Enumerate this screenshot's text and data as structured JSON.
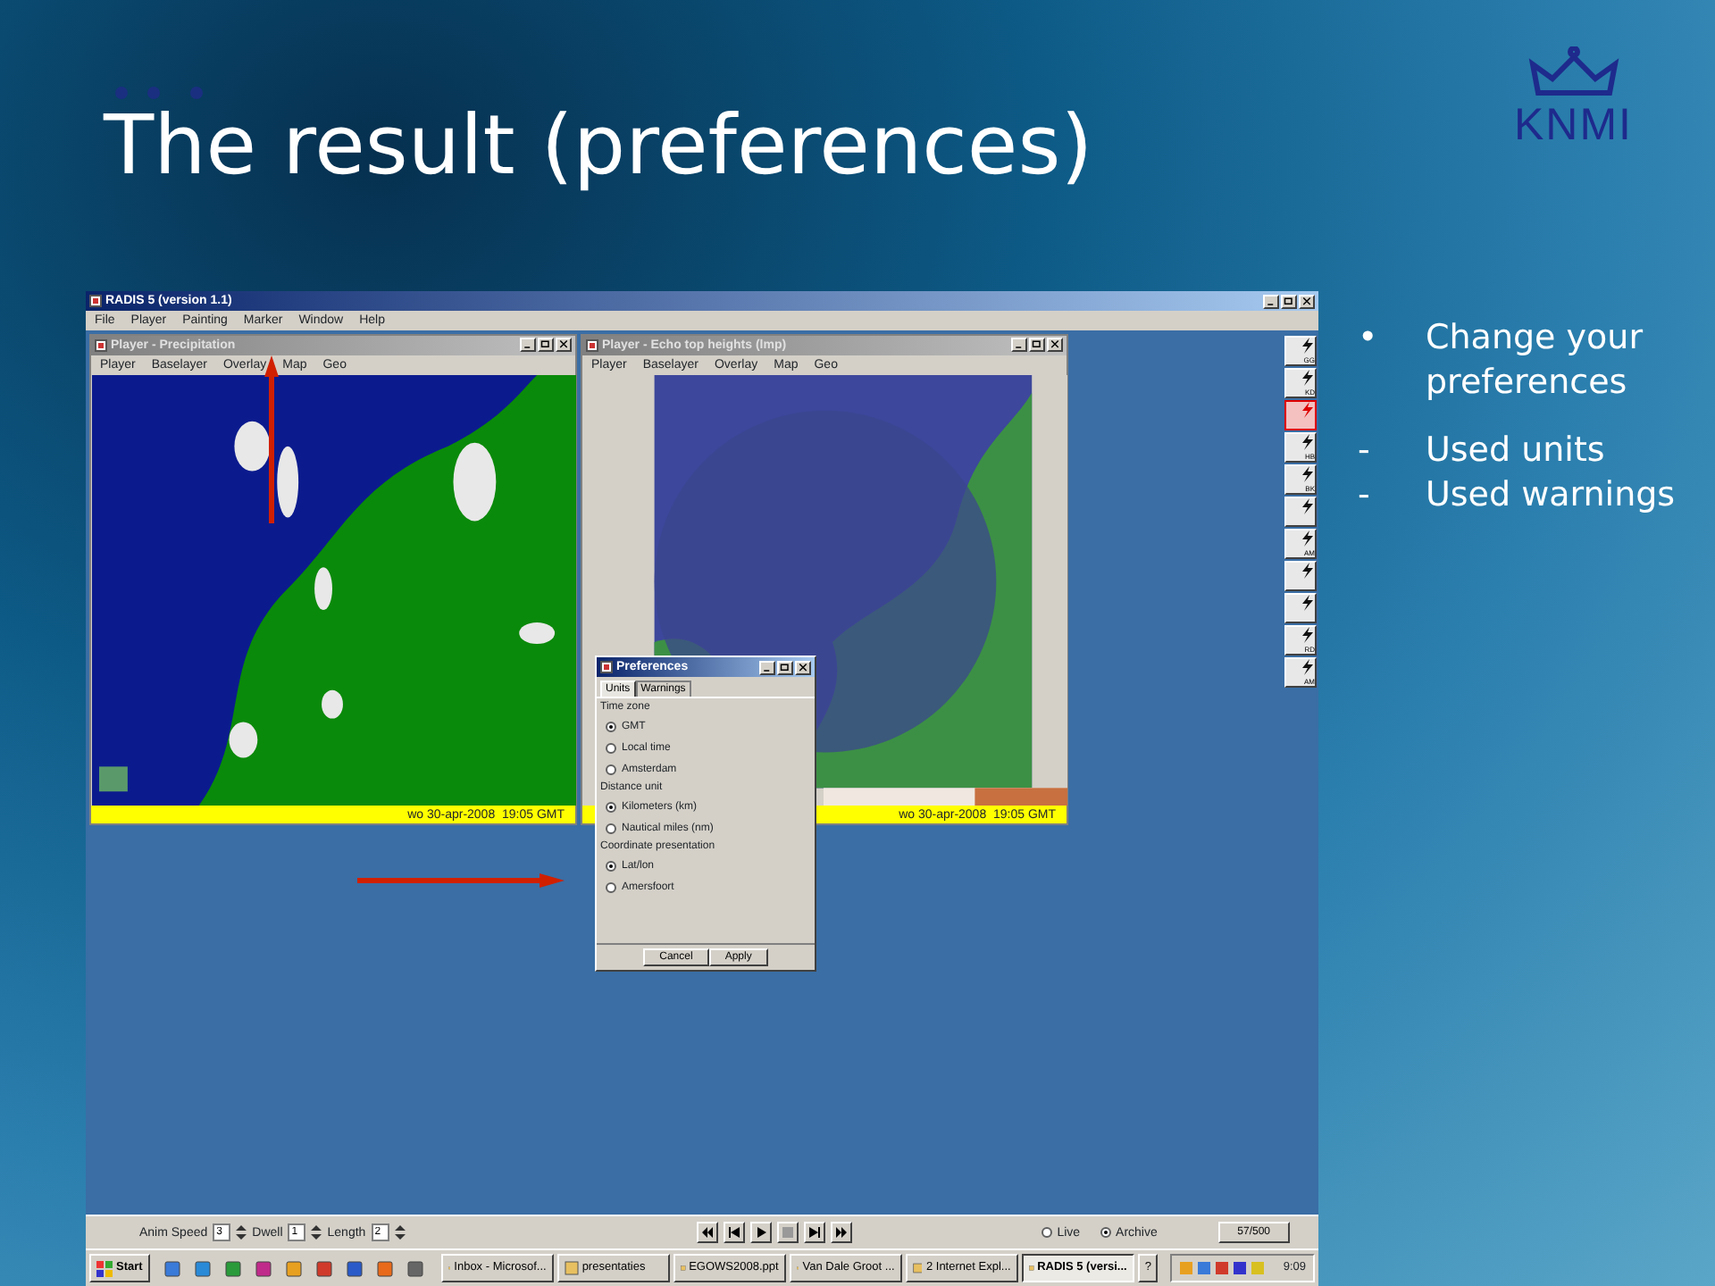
{
  "slide": {
    "title": "The result (preferences)",
    "logo_text": "KNMI"
  },
  "app": {
    "title": "RADIS 5 (version 1.1)",
    "menu": [
      "File",
      "Player",
      "Painting",
      "Marker",
      "Window",
      "Help"
    ],
    "players": [
      {
        "title": "Player - Precipitation",
        "active": false,
        "menu": [
          "Player",
          "Baselayer",
          "Overlay",
          "Map",
          "Geo"
        ],
        "status": "wo 30-apr-2008  19:05 GMT",
        "kind": "precipitation"
      },
      {
        "title": "Player - Echo top heights (lmp)",
        "active": false,
        "menu": [
          "Player",
          "Baselayer",
          "Overlay",
          "Map",
          "Geo"
        ],
        "status": "wo 30-apr-2008  19:05 GMT",
        "kind": "echo"
      }
    ],
    "preferences": {
      "title": "Preferences",
      "tabs": [
        {
          "label": "Units",
          "selected": true
        },
        {
          "label": "Warnings",
          "selected": false
        }
      ],
      "groups": [
        {
          "label": "Time zone",
          "options": [
            {
              "label": "GMT",
              "selected": true
            },
            {
              "label": "Local time",
              "selected": false
            },
            {
              "label": "Amsterdam",
              "selected": false
            }
          ]
        },
        {
          "label": "Distance unit",
          "options": [
            {
              "label": "Kilometers (km)",
              "selected": true
            },
            {
              "label": "Nautical miles (nm)",
              "selected": false
            }
          ]
        },
        {
          "label": "Coordinate presentation",
          "options": [
            {
              "label": "Lat/lon",
              "selected": true
            },
            {
              "label": "Amersfoort",
              "selected": false
            }
          ]
        }
      ],
      "buttons": [
        "Cancel",
        "Apply"
      ]
    },
    "toolbar": [
      {
        "label": "GG",
        "selected": false
      },
      {
        "label": "KD",
        "selected": false
      },
      {
        "selected": true
      },
      {
        "label": "HB",
        "selected": false
      },
      {
        "label": "BK",
        "selected": false
      },
      {
        "selected": false
      },
      {
        "label": "AM",
        "selected": false
      },
      {
        "selected": false
      },
      {
        "selected": false
      },
      {
        "label": "RD",
        "selected": false
      },
      {
        "label": "AM",
        "selected": false
      }
    ],
    "controls": {
      "spinners": [
        {
          "label": "Anim Speed",
          "value": "3"
        },
        {
          "label": "Dwell",
          "value": "1"
        },
        {
          "label": "Length",
          "value": "2"
        }
      ],
      "modes": [
        {
          "label": "Live",
          "selected": false
        },
        {
          "label": "Archive",
          "selected": true
        }
      ],
      "frame": "57/500"
    },
    "taskbar": {
      "start": "Start",
      "tasks": [
        {
          "label": "Inbox - Microsof...",
          "selected": false
        },
        {
          "label": "presentaties",
          "selected": false
        },
        {
          "label": "EGOWS2008.ppt",
          "selected": false
        },
        {
          "label": "Van Dale Groot ...",
          "selected": false
        },
        {
          "label": "2  Internet Expl...",
          "selected": false
        },
        {
          "label": "RADIS 5 (versi...",
          "selected": true
        }
      ],
      "help": "?",
      "clock": "9:09"
    }
  },
  "bullets": [
    {
      "marker": "•",
      "text": "Change your preferences",
      "children": [
        {
          "marker": "-",
          "text": "Used units"
        },
        {
          "marker": "-",
          "text": "Used warnings"
        }
      ]
    }
  ]
}
